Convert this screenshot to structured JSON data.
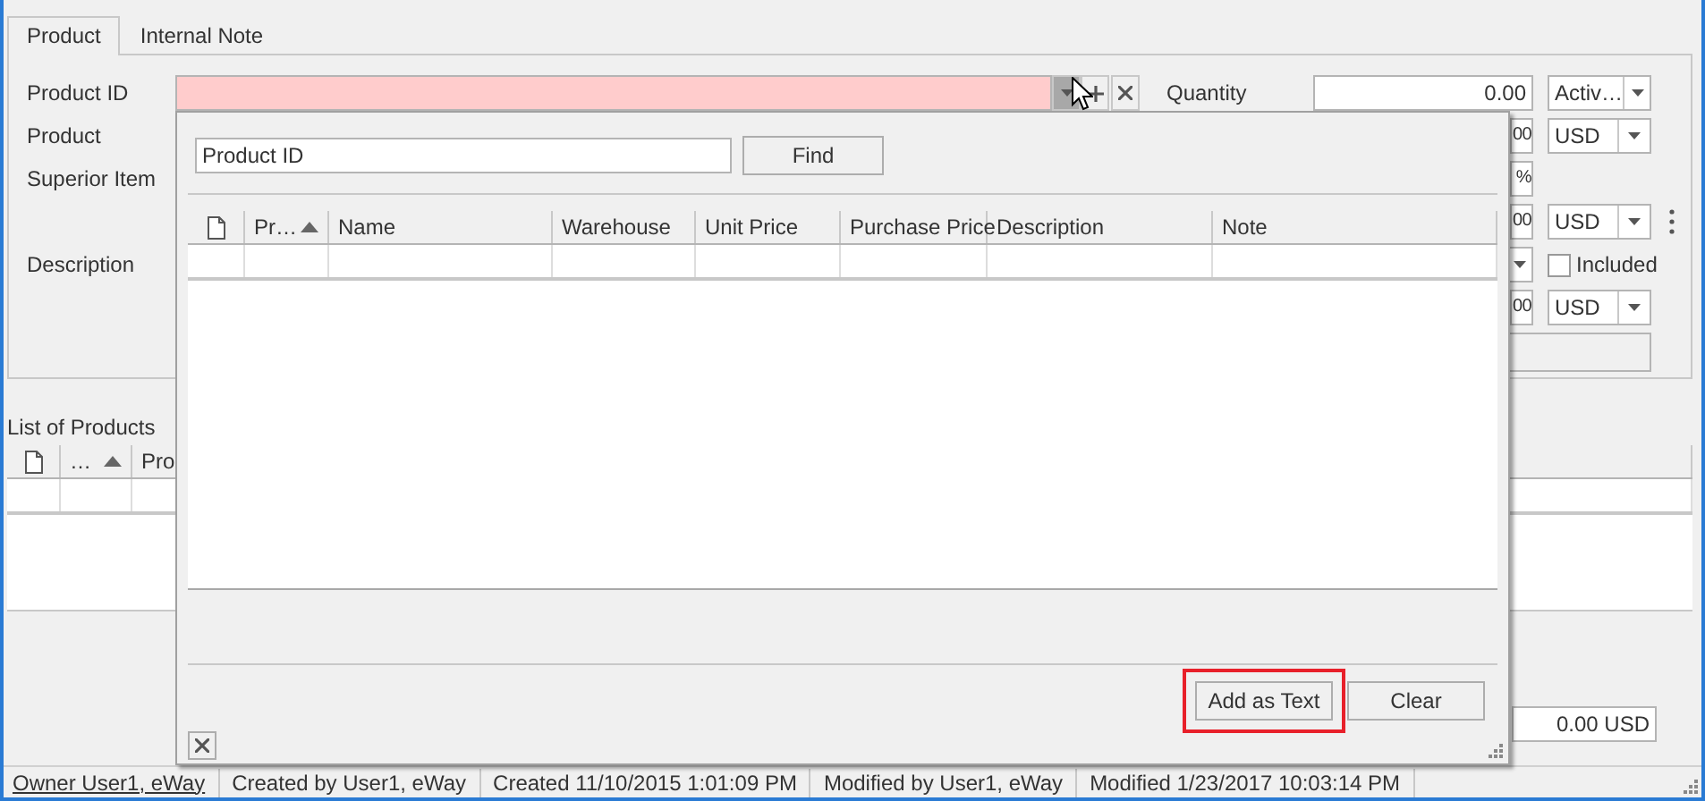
{
  "tabs": [
    {
      "label": "Product",
      "selected": true
    },
    {
      "label": "Internal Note",
      "selected": false
    }
  ],
  "form_rows": [
    {
      "kind": "lookup",
      "caption": "Product ID",
      "invalid": true,
      "dropdown_open": true,
      "label": "Quantity",
      "value": "0.00",
      "combo": "Activ…"
    },
    {
      "kind": "amount",
      "caption": "Product",
      "value": "00",
      "combo": "USD"
    },
    {
      "kind": "percent",
      "caption": "Superior Item",
      "value": "%"
    },
    {
      "kind": "amount",
      "value": "00",
      "combo": "USD",
      "menu_icon": true
    },
    {
      "kind": "check",
      "caption": "Description",
      "label": "Included",
      "checked": false
    },
    {
      "kind": "amount",
      "value": "00",
      "combo": "USD"
    },
    {
      "kind": "blank"
    }
  ],
  "products_list": {
    "title": "List of Products",
    "columns": [
      {
        "label": "…",
        "sort_ascending": true
      },
      {
        "label": "Pro"
      }
    ]
  },
  "total": "0.00 USD",
  "status_bar": [
    {
      "kind": "link",
      "text": "Owner User1, eWay"
    },
    {
      "kind": "text",
      "text": "Created by User1, eWay"
    },
    {
      "kind": "text",
      "text": "Created 11/10/2015 1:01:09 PM"
    },
    {
      "kind": "text",
      "text": "Modified by User1, eWay"
    },
    {
      "kind": "text",
      "text": "Modified 1/23/2017 10:03:14 PM"
    }
  ],
  "popup": {
    "search_value": "Product ID",
    "find_button": "Find",
    "columns": [
      {
        "label": "Pr…",
        "sort_ascending": true
      },
      {
        "label": "Name"
      },
      {
        "label": "Warehouse"
      },
      {
        "label": "Unit Price"
      },
      {
        "label": "Purchase Price"
      },
      {
        "label": "Description"
      },
      {
        "label": "Note"
      }
    ],
    "buttons": [
      {
        "label": "Add as Text",
        "highlighted": true
      },
      {
        "label": "Clear",
        "highlighted": false
      }
    ]
  }
}
